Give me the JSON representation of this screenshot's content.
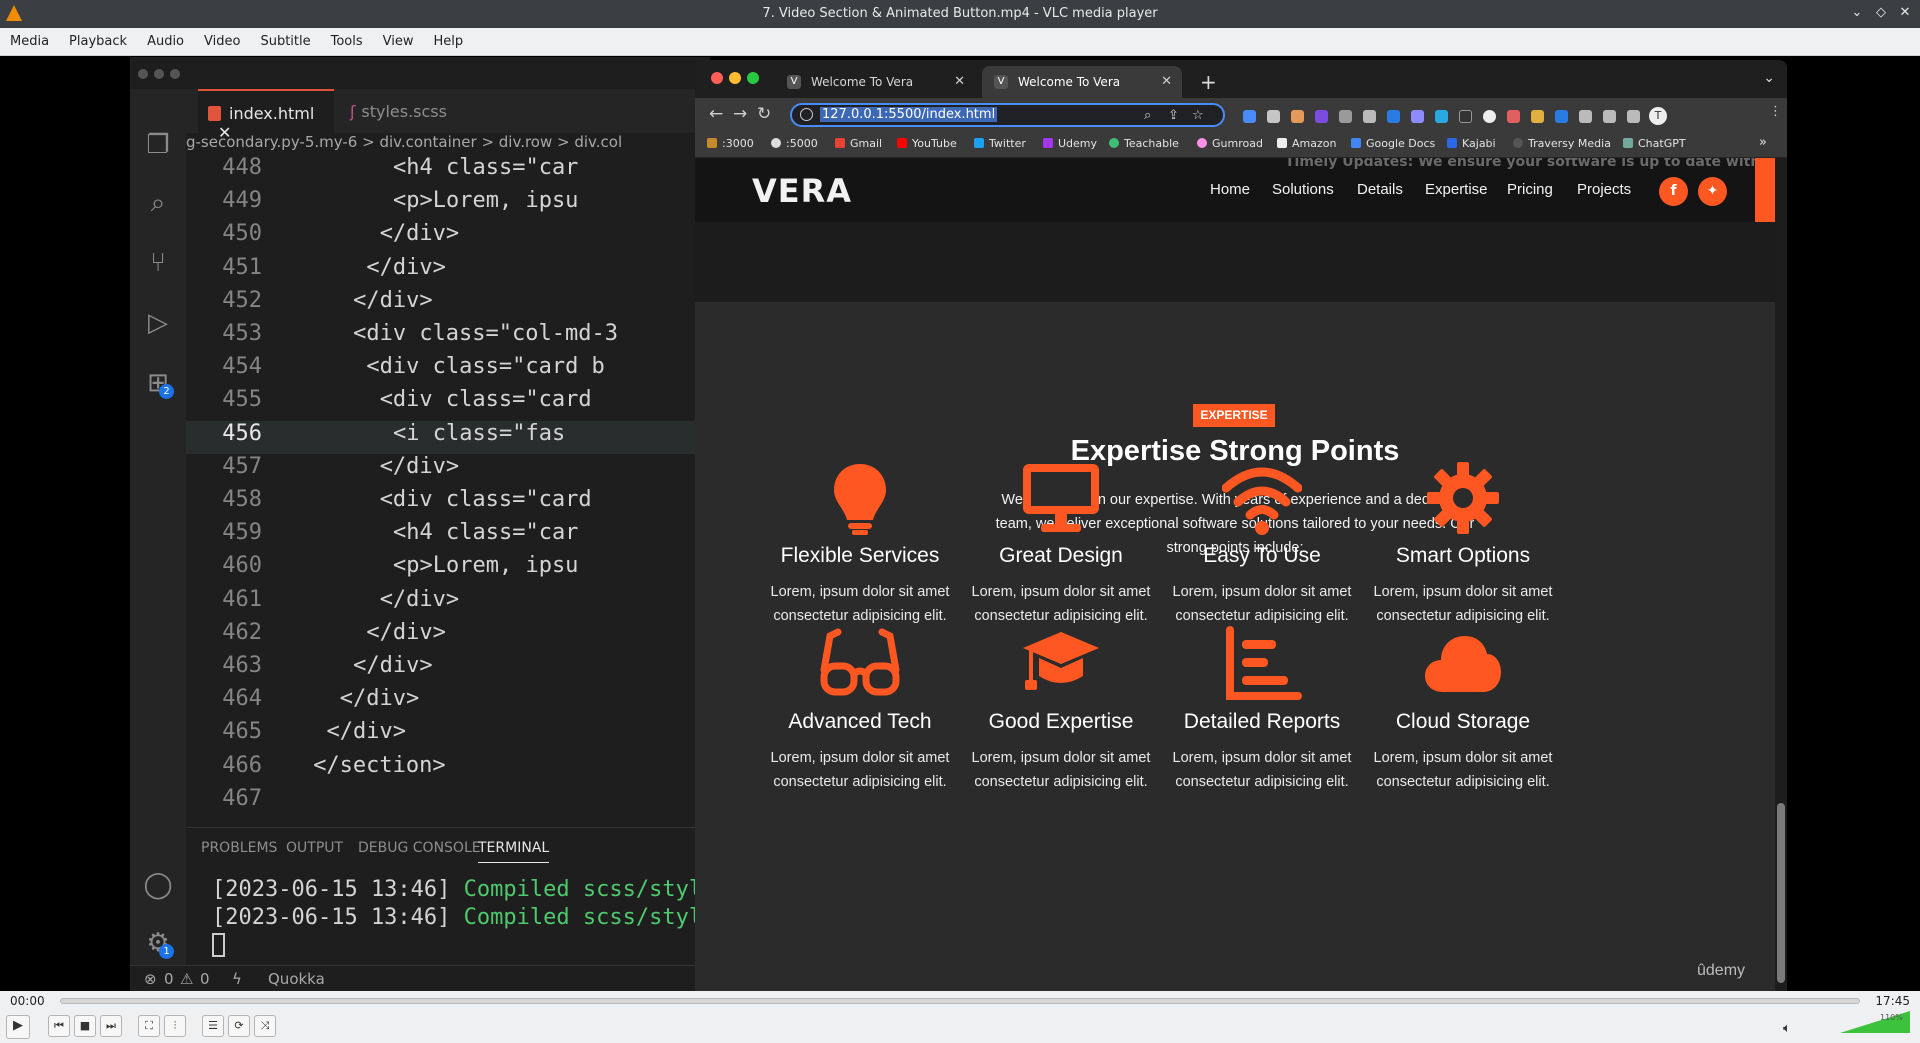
{
  "window": {
    "title": "7. Video Section & Animated Button.mp4 - VLC media player"
  },
  "menubar": [
    "Media",
    "Playback",
    "Audio",
    "Video",
    "Subtitle",
    "Tools",
    "View",
    "Help"
  ],
  "vscode": {
    "tabs": [
      {
        "label": "index.html"
      },
      {
        "label": "styles.scss"
      }
    ],
    "breadcrumb": "g-secondary.py-5.my-6 > div.container > div.row > div.col",
    "extensions_badge": "2",
    "settings_badge": "1",
    "lines": [
      {
        "n": "448",
        "code": "<h4 class=\"car"
      },
      {
        "n": "449",
        "code": "<p>Lorem, ipsu"
      },
      {
        "n": "450",
        "code": "</div>"
      },
      {
        "n": "451",
        "code": "</div>"
      },
      {
        "n": "452",
        "code": "</div>"
      },
      {
        "n": "453",
        "code": "<div class=\"col-md-3"
      },
      {
        "n": "454",
        "code": "<div class=\"card b"
      },
      {
        "n": "455",
        "code": "<div class=\"card"
      },
      {
        "n": "456",
        "code": "<i class=\"fas"
      },
      {
        "n": "457",
        "code": "</div>"
      },
      {
        "n": "458",
        "code": "<div class=\"card"
      },
      {
        "n": "459",
        "code": "<h4 class=\"car"
      },
      {
        "n": "460",
        "code": "<p>Lorem, ipsu"
      },
      {
        "n": "461",
        "code": "</div>"
      },
      {
        "n": "462",
        "code": "</div>"
      },
      {
        "n": "463",
        "code": "</div>"
      },
      {
        "n": "464",
        "code": "</div>"
      },
      {
        "n": "465",
        "code": "</div>"
      },
      {
        "n": "466",
        "code": "</section>"
      },
      {
        "n": "467",
        "code": ""
      }
    ],
    "panel_tabs": [
      "PROBLEMS",
      "OUTPUT",
      "DEBUG CONSOLE",
      "TERMINAL"
    ],
    "terminal": [
      {
        "time": "[2023-06-15 13:46]",
        "msg": "Compiled scss/style"
      },
      {
        "time": "[2023-06-15 13:46]",
        "msg": "Compiled scss/style"
      }
    ],
    "status": {
      "errors": "0",
      "warnings": "0",
      "quokka": "Quokka"
    }
  },
  "browser": {
    "tabs": [
      {
        "title": "Welcome To Vera"
      },
      {
        "title": "Welcome To Vera"
      }
    ],
    "url": "127.0.0.1:5500/index.html",
    "bookmarks": [
      ":3000",
      ":5000",
      "Gmail",
      "YouTube",
      "Twitter",
      "Udemy",
      "Teachable",
      "Gumroad",
      "Amazon",
      "Google Docs",
      "Kajabi",
      "Traversy Media",
      "ChatGPT"
    ]
  },
  "site": {
    "logo": "VERA",
    "ghost_text": "Timely Updates: We ensure your software is up to date with",
    "nav": [
      "Home",
      "Solutions",
      "Details",
      "Expertise",
      "Pricing",
      "Projects"
    ],
    "badge": "EXPERTISE",
    "title": "Expertise Strong Points",
    "description": "We take pride in our expertise. With years of experience and a dedicated team, we deliver exceptional software solutions tailored to your needs. Our strong points include:",
    "cards": [
      {
        "title": "Flexible Services",
        "text": "Lorem, ipsum dolor sit amet consectetur adipisicing elit.",
        "icon": "lightbulb-icon"
      },
      {
        "title": "Great Design",
        "text": "Lorem, ipsum dolor sit amet consectetur adipisicing elit.",
        "icon": "desktop-icon"
      },
      {
        "title": "Easy To Use",
        "text": "Lorem, ipsum dolor sit amet consectetur adipisicing elit.",
        "icon": "wifi-icon"
      },
      {
        "title": "Smart Options",
        "text": "Lorem, ipsum dolor sit amet consectetur adipisicing elit.",
        "icon": "gear-icon"
      },
      {
        "title": "Advanced Tech",
        "text": "Lorem, ipsum dolor sit amet consectetur adipisicing elit.",
        "icon": "glasses-icon"
      },
      {
        "title": "Good Expertise",
        "text": "Lorem, ipsum dolor sit amet consectetur adipisicing elit.",
        "icon": "graduation-cap-icon"
      },
      {
        "title": "Detailed Reports",
        "text": "Lorem, ipsum dolor sit amet consectetur adipisicing elit.",
        "icon": "chart-bars-icon"
      },
      {
        "title": "Cloud Storage",
        "text": "Lorem, ipsum dolor sit amet consectetur adipisicing elit.",
        "icon": "cloud-icon"
      }
    ],
    "accent": "#ff5722",
    "watermark": "ûdemy"
  },
  "player": {
    "time_current": "00:00",
    "time_total": "17:45",
    "volume": "110%",
    "progress": 0
  }
}
